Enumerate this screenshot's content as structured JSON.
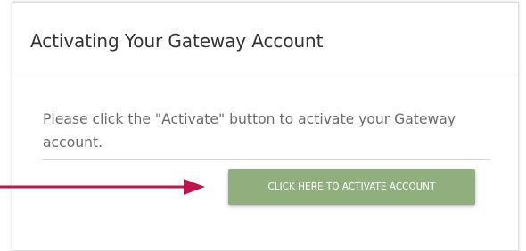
{
  "dialog": {
    "title": "Activating Your Gateway Account",
    "message": "Please click the \"Activate\" button to activate your Gateway account.",
    "activate_button_label": "CLICK HERE TO ACTIVATE ACCOUNT"
  },
  "colors": {
    "button_background": "#91ae7f",
    "arrow": "#c0144e"
  },
  "icons": {
    "pointer_arrow": "arrow-right-icon"
  }
}
